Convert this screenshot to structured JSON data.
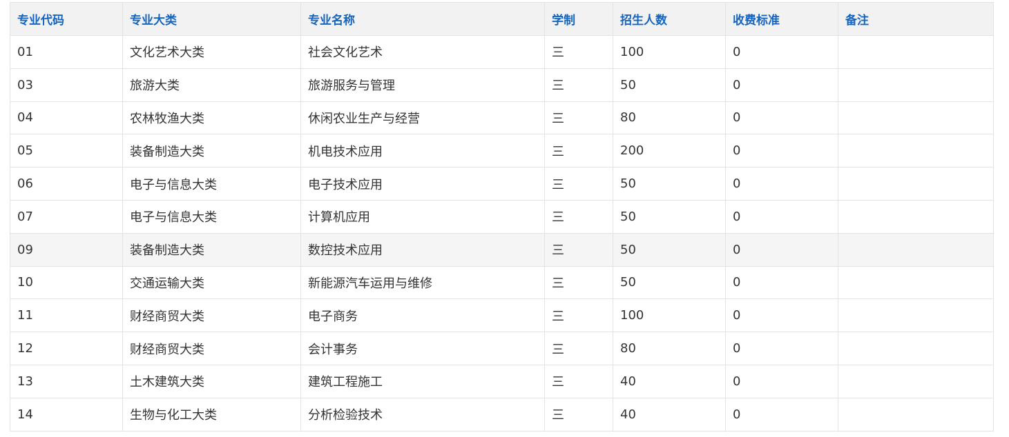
{
  "table": {
    "headers": [
      "专业代码",
      "专业大类",
      "专业名称",
      "学制",
      "招生人数",
      "收费标准",
      "备注"
    ],
    "rows": [
      [
        "01",
        "文化艺术大类",
        "社会文化艺术",
        "三",
        "100",
        "0",
        ""
      ],
      [
        "03",
        "旅游大类",
        "旅游服务与管理",
        "三",
        "50",
        "0",
        ""
      ],
      [
        "04",
        "农林牧渔大类",
        "休闲农业生产与经营",
        "三",
        "80",
        "0",
        ""
      ],
      [
        "05",
        "装备制造大类",
        "机电技术应用",
        "三",
        "200",
        "0",
        ""
      ],
      [
        "06",
        "电子与信息大类",
        "电子技术应用",
        "三",
        "50",
        "0",
        ""
      ],
      [
        "07",
        "电子与信息大类",
        "计算机应用",
        "三",
        "50",
        "0",
        ""
      ],
      [
        "09",
        "装备制造大类",
        "数控技术应用",
        "三",
        "50",
        "0",
        ""
      ],
      [
        "10",
        "交通运输大类",
        "新能源汽车运用与维修",
        "三",
        "50",
        "0",
        ""
      ],
      [
        "11",
        "财经商贸大类",
        "电子商务",
        "三",
        "100",
        "0",
        ""
      ],
      [
        "12",
        "财经商贸大类",
        "会计事务",
        "三",
        "80",
        "0",
        ""
      ],
      [
        "13",
        "土木建筑大类",
        "建筑工程施工",
        "三",
        "40",
        "0",
        ""
      ],
      [
        "14",
        "生物与化工大类",
        "分析检验技术",
        "三",
        "40",
        "0",
        ""
      ]
    ]
  },
  "colors": {
    "header_text": "#1565c0",
    "header_bg": "#f2f2f2",
    "hover_row_bg": "#f5f5f5",
    "border": "#e3e3e3"
  }
}
